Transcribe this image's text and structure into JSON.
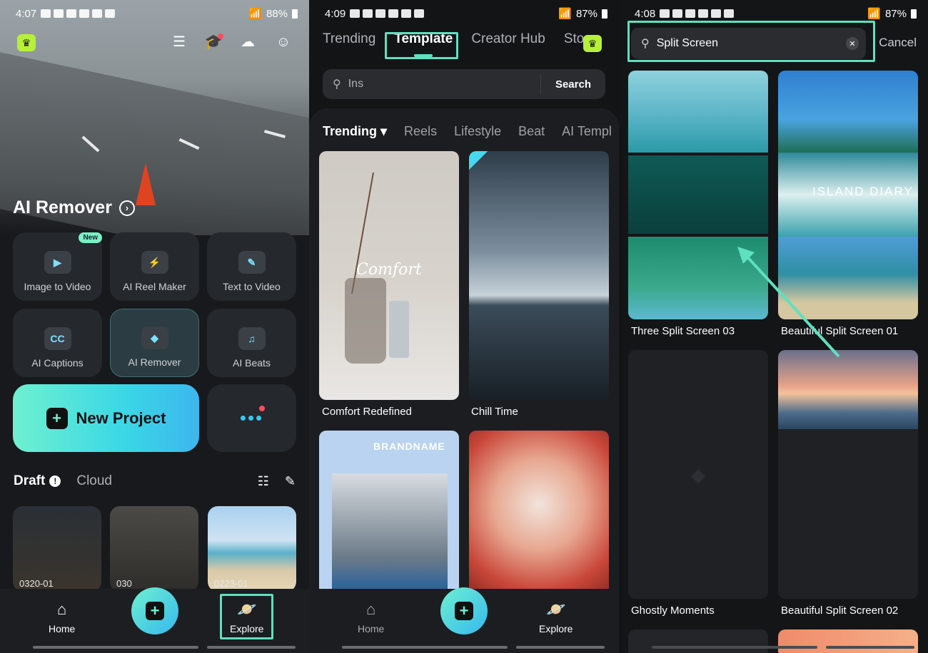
{
  "status": [
    {
      "time": "4:07",
      "battery": "88%"
    },
    {
      "time": "4:09",
      "battery": "87%"
    },
    {
      "time": "4:08",
      "battery": "87%"
    }
  ],
  "panel1": {
    "hero_title": "AI Remover",
    "tools": [
      {
        "label": "Image to Video",
        "badge": "New",
        "icon": "image-to-video-icon"
      },
      {
        "label": "AI Reel Maker",
        "icon": "reel-maker-icon"
      },
      {
        "label": "Text to Video",
        "icon": "text-to-video-icon"
      },
      {
        "label": "AI Captions",
        "icon_text": "CC",
        "icon": "captions-icon"
      },
      {
        "label": "AI Remover",
        "icon": "eraser-icon"
      },
      {
        "label": "AI Beats",
        "icon": "beats-icon"
      }
    ],
    "new_project": "New Project",
    "drafts": {
      "title": "Draft",
      "cloud": "Cloud"
    },
    "thumbs": [
      "0320-01",
      "030",
      "0223-01"
    ],
    "nav": {
      "home": "Home",
      "explore": "Explore"
    }
  },
  "panel2": {
    "tabs": [
      "Trending",
      "Template",
      "Creator Hub",
      "Sto"
    ],
    "search_placeholder": "Ins",
    "search_button": "Search",
    "categories": [
      "Trending",
      "Reels",
      "Lifestyle",
      "Beat",
      "AI Templ"
    ],
    "cards": [
      {
        "title": "Comfort Redefined",
        "overlay": "Comfort"
      },
      {
        "title": "Chill Time"
      },
      {
        "brand": "BRANDNAME"
      },
      {}
    ],
    "nav": {
      "home": "Home",
      "explore": "Explore"
    }
  },
  "panel3": {
    "search_value": "Split Screen",
    "cancel": "Cancel",
    "results": [
      {
        "title": "Three Split Screen 03"
      },
      {
        "title": "Beautiful Split Screen 01",
        "overlay": "ISLAND DIARY"
      },
      {
        "title": "Ghostly Moments"
      },
      {
        "title": "Beautiful Split Screen 02"
      }
    ]
  }
}
